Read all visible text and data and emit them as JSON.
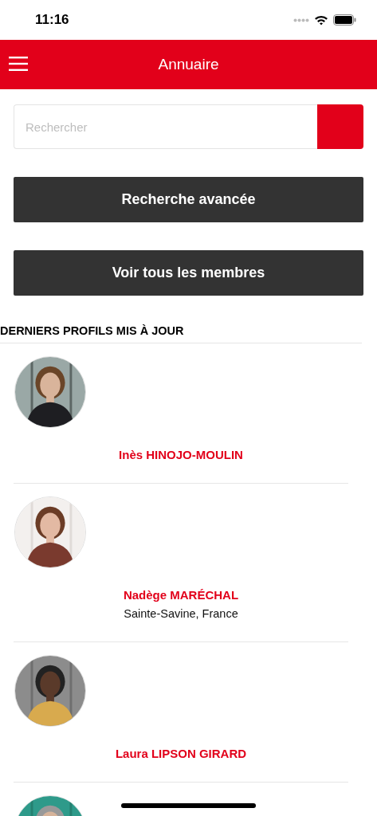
{
  "status_bar": {
    "time": "11:16"
  },
  "header": {
    "title": "Annuaire"
  },
  "search": {
    "placeholder": "Rechercher"
  },
  "buttons": [
    {
      "label": "Recherche avancée"
    },
    {
      "label": "Voir tous les membres"
    }
  ],
  "section_title": "DERNIERS PROFILS MIS À JOUR",
  "profiles": [
    {
      "avatar": {
        "kind": "picture"
      },
      "name": "Inès HINOJO-MOULIN"
    },
    {
      "avatar": {
        "kind": "picture"
      },
      "name": "Nadège MARÉCHAL",
      "location": "Sainte-Savine, France"
    },
    {
      "avatar": {
        "kind": "picture"
      },
      "name": "Laura LIPSON GIRARD"
    },
    {
      "avatar": {
        "kind": "picture"
      }
    }
  ]
}
